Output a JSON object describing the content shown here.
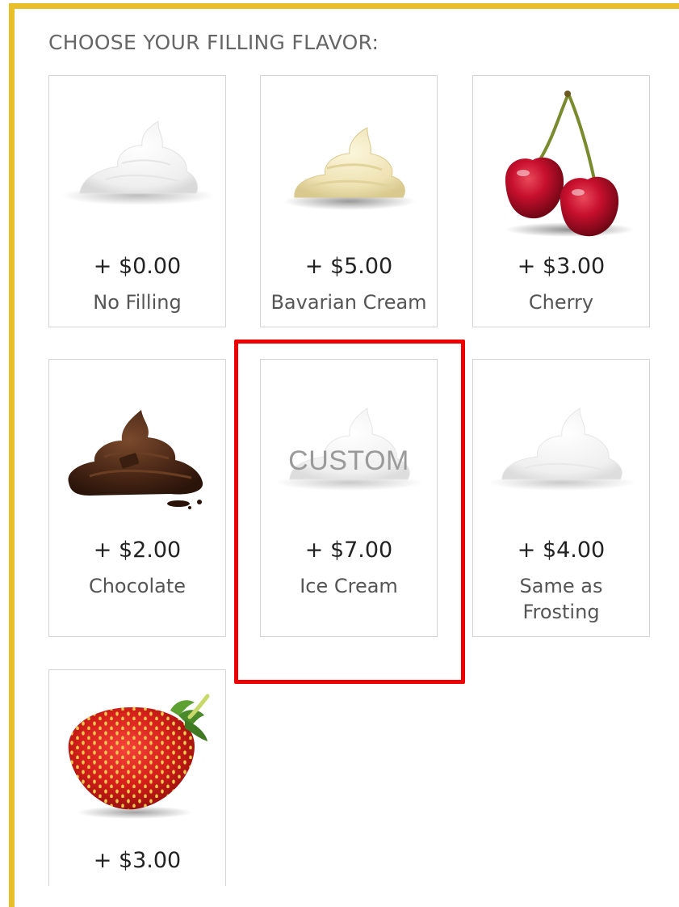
{
  "heading": "CHOOSE YOUR FILLING FLAVOR:",
  "colors": {
    "accent": "#e8bf2a",
    "highlight": "#ee0000"
  },
  "options": [
    {
      "price": "+ $0.00",
      "label": "No Filling",
      "image": "whipped-cream-icon"
    },
    {
      "price": "+ $5.00",
      "label": "Bavarian Cream",
      "image": "bavarian-cream-icon"
    },
    {
      "price": "+ $3.00",
      "label": "Cherry",
      "image": "cherry-icon"
    },
    {
      "price": "+ $2.00",
      "label": "Chocolate",
      "image": "chocolate-icon"
    },
    {
      "price": "+ $7.00",
      "label": "Ice Cream",
      "image": "custom-cream-icon",
      "overlay": "CUSTOM"
    },
    {
      "price": "+ $4.00",
      "label": "Same as\nFrosting",
      "label_line1": "Same as",
      "label_line2": "Frosting",
      "image": "whipped-cream-icon"
    },
    {
      "price": "+ $3.00",
      "label": "",
      "image": "strawberry-icon"
    }
  ]
}
